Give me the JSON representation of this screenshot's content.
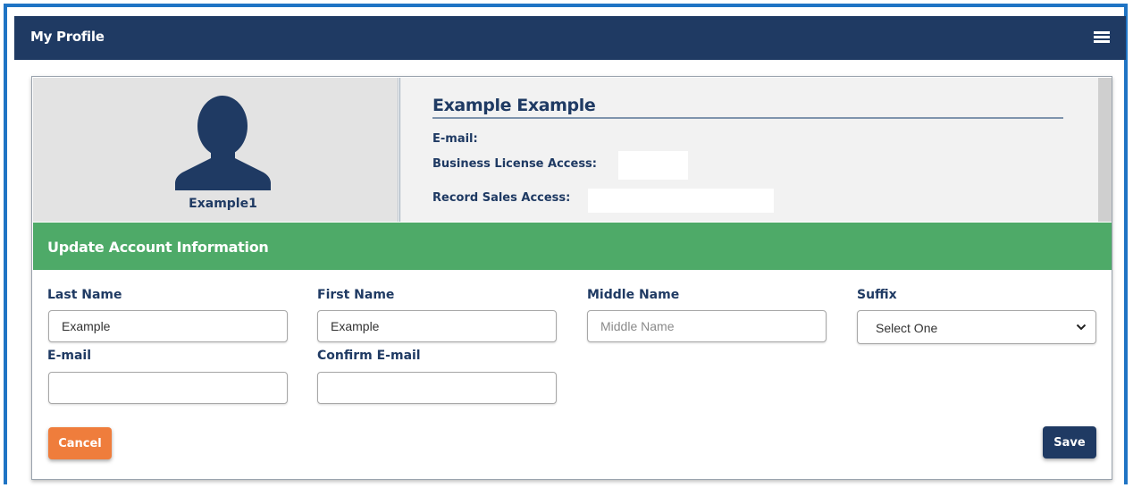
{
  "header": {
    "title": "My Profile",
    "menu_icon": "hamburger-menu-icon"
  },
  "profile": {
    "avatar_icon": "user-silhouette-icon",
    "username": "Example1",
    "full_name": "Example Example",
    "email_label": "E-mail:",
    "business_license_label": "Business License Access:",
    "record_sales_label": "Record Sales Access:"
  },
  "form": {
    "section_title": "Update Account Information",
    "last_name": {
      "label": "Last Name",
      "value": "Example"
    },
    "first_name": {
      "label": "First Name",
      "value": "Example"
    },
    "middle_name": {
      "label": "Middle Name",
      "value": "",
      "placeholder": "Middle Name"
    },
    "suffix": {
      "label": "Suffix",
      "selected": "Select One"
    },
    "email": {
      "label": "E-mail",
      "value": ""
    },
    "confirm_email": {
      "label": "Confirm E-mail",
      "value": ""
    }
  },
  "buttons": {
    "cancel": "Cancel",
    "save": "Save"
  },
  "colors": {
    "header_bg": "#1f3a63",
    "section_bg": "#4eaa68",
    "cancel_bg": "#ef7d3c",
    "save_bg": "#1f3a63",
    "frame_border": "#1f74c4"
  }
}
